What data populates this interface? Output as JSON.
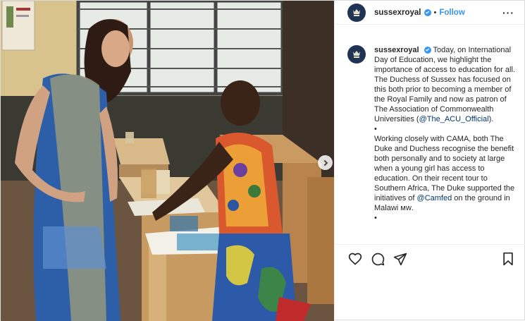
{
  "post": {
    "username": "sussexroyal",
    "follow_label": "Follow",
    "dot": "•",
    "more_label": "···"
  },
  "caption": {
    "username": "sussexroyal",
    "para1_a": "Today, on International Day of Education, we highlight the importance of access to education for all. The Duchess of Sussex has focused on this both prior to becoming a member of the Royal Family and now as patron of The Association of Commonwealth Universities (",
    "mention1": "@The_ACU_Official",
    "para1_b": ").",
    "bullet1": "•",
    "para2_a": "Working closely with CAMA, both The Duke and Duchess recognise the benefit both personally and to society at large when a young girl has access to education. On their recent tour to Southern Africa, The Duke supported the initiatives of ",
    "mention2": "@Camfed",
    "para2_b": " on the ground in Malawi ᴍᴡ.",
    "bullet2": "•"
  },
  "icons": {
    "like": "heart-icon",
    "comment": "comment-icon",
    "share": "paper-plane-icon",
    "save": "bookmark-icon",
    "next": "chevron-right-icon",
    "verified": "verified-badge-icon",
    "avatar": "royal-crest-icon"
  },
  "colors": {
    "link_blue": "#3897f0",
    "mention": "#00376b",
    "avatar_bg": "#1f3355"
  }
}
